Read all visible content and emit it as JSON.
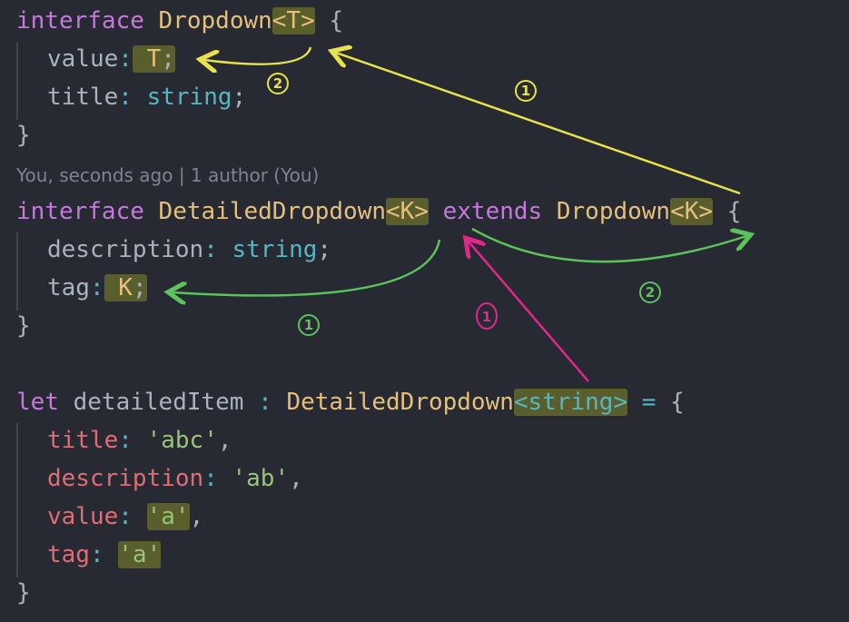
{
  "colors": {
    "background": "#272a33",
    "keyword": "#c678dd",
    "type": "#e5c07b",
    "string": "#98c379",
    "type_keyword": "#56b6c2",
    "property_red": "#e06c75",
    "highlight": "#5a5e2c",
    "annotation_yellow": "#e8e24b",
    "annotation_green": "#5cc25c",
    "annotation_pink": "#e0278a"
  },
  "code": {
    "line1": {
      "kw": "interface",
      "name": "Dropdown",
      "generic": "<T>",
      "brace": "{"
    },
    "line2": {
      "prop": "value",
      "colon": ":",
      "type": "T",
      "semi": ";"
    },
    "line3": {
      "prop": "title",
      "colon": ":",
      "type": "string",
      "semi": ";"
    },
    "line4": {
      "brace": "}"
    },
    "blame": "You, seconds ago | 1 author (You)",
    "line5": {
      "kw": "interface",
      "name": "DetailedDropdown",
      "generic": "<K>",
      "kw2": "extends",
      "parent": "Dropdown",
      "generic2": "<K>",
      "brace": "{"
    },
    "line6": {
      "prop": "description",
      "colon": ":",
      "type": "string",
      "semi": ";"
    },
    "line7": {
      "prop": "tag",
      "colon": ":",
      "type": "K",
      "semi": ";"
    },
    "line8": {
      "brace": "}"
    },
    "line10": {
      "kw": "let",
      "var": "detailedItem",
      "colon": ":",
      "type": "DetailedDropdown",
      "generic": "<string>",
      "eq": "=",
      "brace": "{"
    },
    "line11": {
      "prop": "title",
      "colon": ":",
      "value": "'abc'",
      "comma": ","
    },
    "line12": {
      "prop": "description",
      "colon": ":",
      "value": "'ab'",
      "comma": ","
    },
    "line13": {
      "prop": "value",
      "colon": ":",
      "value": "'a'",
      "comma": ","
    },
    "line14": {
      "prop": "tag",
      "colon": ":",
      "value": "'a'"
    },
    "line15": {
      "brace": "}"
    }
  },
  "annotations": {
    "yellow_1": "1",
    "yellow_2": "2",
    "green_1": "1",
    "green_2": "2",
    "pink_1": "1"
  }
}
